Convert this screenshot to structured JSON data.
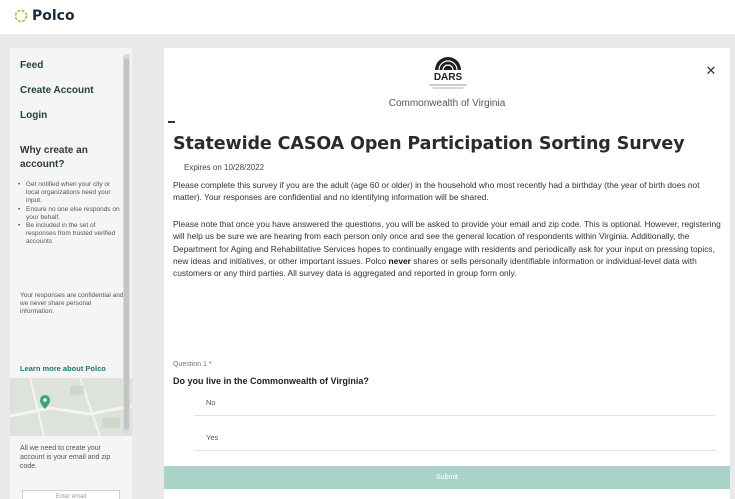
{
  "app": {
    "logo_text": "Polco"
  },
  "sidebar": {
    "nav": [
      "Feed",
      "Create Account",
      "Login"
    ],
    "why_heading": "Why create an account?",
    "bullets": [
      "Get notified when your city or local organizations need your input.",
      "Ensure no one else responds on your behalf.",
      "Be included in the set of responses from trusted verified accounts"
    ],
    "confidential_text": "Your responses are confidential and we never share personal information.",
    "learn_more": "Learn more about Polco",
    "need_text": "All we need to create your account is your email and zip code.",
    "email_placeholder": "Enter email"
  },
  "modal": {
    "agency_logo_text": "DARS",
    "agency_name": "Commonwealth of Virginia",
    "title": "Statewide CASOA Open Participation Sorting Survey",
    "expires": "Expires on 10/28/2022",
    "intro": "Please complete this survey if you are the adult (age 60 or older) in the household who most recently had a birthday (the year of birth does not matter). Your responses are confidential and no identifying information will be shared.",
    "privacy_before": "Please note that once you have answered the questions, you will be asked to provide your email and zip code. This is optional. However, registering will help us be sure we are hearing from each person only once and see the general location of respondents within Virginia. Additionally, the Department for Aging and Rehabilitative Services hopes to continually engage with residents and periodically ask for your input on pressing topics, new ideas and initiatives, or other important issues. Polco",
    "privacy_bold": "never",
    "privacy_after": "shares or sells personally identifiable information or individual-level data with customers or any third parties. All survey data is aggregated and reported in group form only.",
    "question_label": "Question 1",
    "required_mark": "*",
    "question_text": "Do you live in the Commonwealth of Virginia?",
    "options": [
      "No",
      "Yes"
    ],
    "submit_label": "Submit"
  },
  "colors": {
    "brand_green": "#1d7a68",
    "submit_bg": "#a9d3c8"
  }
}
